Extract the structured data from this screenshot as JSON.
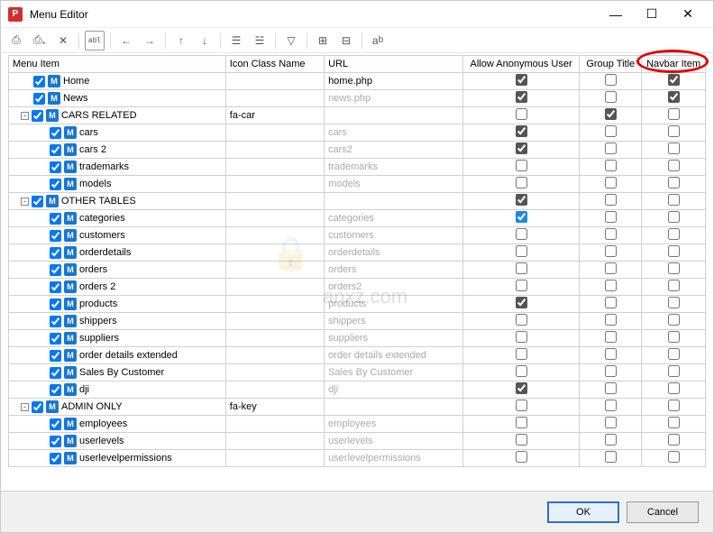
{
  "window": {
    "title": "Menu Editor",
    "minimize": "—",
    "maximize": "☐",
    "close": "✕"
  },
  "toolbar": {
    "items": [
      "add",
      "add-child",
      "delete",
      "rename",
      "move-left",
      "move-right",
      "move-up",
      "move-down",
      "sort",
      "filter",
      "funnel",
      "expand",
      "collapse",
      "refresh"
    ]
  },
  "columns": {
    "menu_item": "Menu Item",
    "icon_class": "Icon Class Name",
    "url": "URL",
    "allow_anon": "Allow Anonymous User",
    "group_title": "Group Title",
    "navbar_item": "Navbar Item"
  },
  "rows": [
    {
      "depth": 0,
      "exp": "",
      "sel": true,
      "icon": "M",
      "label": "Home",
      "iconClass": "",
      "url": "home.php",
      "urlDim": false,
      "anon": true,
      "group": false,
      "nav": true
    },
    {
      "depth": 0,
      "exp": "",
      "sel": true,
      "icon": "M",
      "label": "News",
      "iconClass": "",
      "url": "news.php",
      "urlDim": true,
      "anon": true,
      "group": false,
      "nav": true
    },
    {
      "depth": 0,
      "exp": "-",
      "sel": true,
      "icon": "M",
      "label": "CARS RELATED",
      "iconClass": "fa-car",
      "url": "",
      "urlDim": false,
      "anon": false,
      "group": true,
      "nav": false
    },
    {
      "depth": 1,
      "exp": "",
      "sel": true,
      "icon": "M",
      "label": "cars",
      "iconClass": "",
      "url": "cars",
      "urlDim": true,
      "anon": true,
      "group": false,
      "nav": false
    },
    {
      "depth": 1,
      "exp": "",
      "sel": true,
      "icon": "M",
      "label": "cars 2",
      "iconClass": "",
      "url": "cars2",
      "urlDim": true,
      "anon": true,
      "group": false,
      "nav": false
    },
    {
      "depth": 1,
      "exp": "",
      "sel": true,
      "icon": "M",
      "label": "trademarks",
      "iconClass": "",
      "url": "trademarks",
      "urlDim": true,
      "anon": false,
      "group": false,
      "nav": false
    },
    {
      "depth": 1,
      "exp": "",
      "sel": true,
      "icon": "M",
      "label": "models",
      "iconClass": "",
      "url": "models",
      "urlDim": true,
      "anon": false,
      "group": false,
      "nav": false
    },
    {
      "depth": 0,
      "exp": "-",
      "sel": true,
      "icon": "M",
      "label": "OTHER TABLES",
      "iconClass": "",
      "url": "",
      "urlDim": false,
      "anon": true,
      "group": false,
      "nav": false
    },
    {
      "depth": 1,
      "exp": "",
      "sel": true,
      "icon": "M",
      "label": "categories",
      "iconClass": "",
      "url": "categories",
      "urlDim": true,
      "anon": "blue",
      "group": false,
      "nav": false
    },
    {
      "depth": 1,
      "exp": "",
      "sel": true,
      "icon": "M",
      "label": "customers",
      "iconClass": "",
      "url": "customers",
      "urlDim": true,
      "anon": false,
      "group": false,
      "nav": false
    },
    {
      "depth": 1,
      "exp": "",
      "sel": true,
      "icon": "M",
      "label": "orderdetails",
      "iconClass": "",
      "url": "orderdetails",
      "urlDim": true,
      "anon": false,
      "group": false,
      "nav": false
    },
    {
      "depth": 1,
      "exp": "",
      "sel": true,
      "icon": "M",
      "label": "orders",
      "iconClass": "",
      "url": "orders",
      "urlDim": true,
      "anon": false,
      "group": false,
      "nav": false
    },
    {
      "depth": 1,
      "exp": "",
      "sel": true,
      "icon": "M",
      "label": "orders 2",
      "iconClass": "",
      "url": "orders2",
      "urlDim": true,
      "anon": false,
      "group": false,
      "nav": false
    },
    {
      "depth": 1,
      "exp": "",
      "sel": true,
      "icon": "M",
      "label": "products",
      "iconClass": "",
      "url": "products",
      "urlDim": true,
      "anon": true,
      "group": false,
      "nav": false
    },
    {
      "depth": 1,
      "exp": "",
      "sel": true,
      "icon": "M",
      "label": "shippers",
      "iconClass": "",
      "url": "shippers",
      "urlDim": true,
      "anon": false,
      "group": false,
      "nav": false
    },
    {
      "depth": 1,
      "exp": "",
      "sel": true,
      "icon": "M",
      "label": "suppliers",
      "iconClass": "",
      "url": "suppliers",
      "urlDim": true,
      "anon": false,
      "group": false,
      "nav": false
    },
    {
      "depth": 1,
      "exp": "",
      "sel": true,
      "icon": "M",
      "label": "order details extended",
      "iconClass": "",
      "url": "order details extended",
      "urlDim": true,
      "anon": false,
      "group": false,
      "nav": false
    },
    {
      "depth": 1,
      "exp": "",
      "sel": true,
      "icon": "M",
      "label": "Sales By Customer",
      "iconClass": "",
      "url": "Sales By Customer",
      "urlDim": true,
      "anon": false,
      "group": false,
      "nav": false
    },
    {
      "depth": 1,
      "exp": "",
      "sel": true,
      "icon": "M",
      "label": "dji",
      "iconClass": "",
      "url": "dji",
      "urlDim": true,
      "anon": true,
      "group": false,
      "nav": false
    },
    {
      "depth": 0,
      "exp": "-",
      "sel": true,
      "icon": "M",
      "label": "ADMIN ONLY",
      "iconClass": "fa-key",
      "url": "",
      "urlDim": false,
      "anon": false,
      "group": false,
      "nav": false
    },
    {
      "depth": 1,
      "exp": "",
      "sel": true,
      "icon": "M",
      "label": "employees",
      "iconClass": "",
      "url": "employees",
      "urlDim": true,
      "anon": false,
      "group": false,
      "nav": false
    },
    {
      "depth": 1,
      "exp": "",
      "sel": true,
      "icon": "M",
      "label": "userlevels",
      "iconClass": "",
      "url": "userlevels",
      "urlDim": true,
      "anon": false,
      "group": false,
      "nav": false
    },
    {
      "depth": 1,
      "exp": "",
      "sel": true,
      "icon": "M",
      "label": "userlevelpermissions",
      "iconClass": "",
      "url": "userlevelpermissions",
      "urlDim": true,
      "anon": false,
      "group": false,
      "nav": false
    }
  ],
  "footer": {
    "ok": "OK",
    "cancel": "Cancel"
  },
  "watermark": {
    "icon": "🔒",
    "text": "anxz.com"
  }
}
